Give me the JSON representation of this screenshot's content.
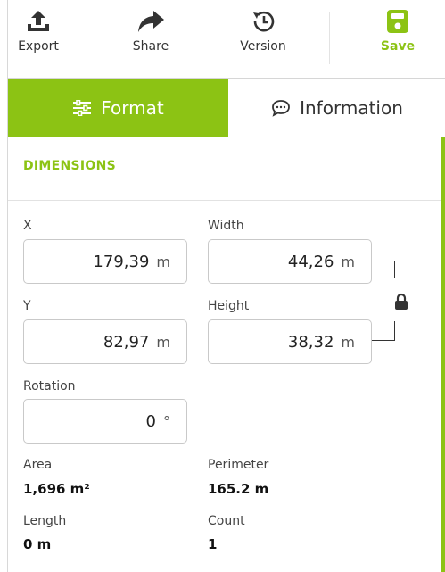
{
  "toolbar": {
    "export_label": "Export",
    "share_label": "Share",
    "version_label": "Version",
    "save_label": "Save",
    "accent_color": "#8cc314"
  },
  "tabs": {
    "format_label": "Format",
    "information_label": "Information",
    "active": "Format"
  },
  "dimensions": {
    "section_title": "DIMENSIONS",
    "x": {
      "label": "X",
      "value": "179,39",
      "unit": "m"
    },
    "width": {
      "label": "Width",
      "value": "44,26",
      "unit": "m"
    },
    "y": {
      "label": "Y",
      "value": "82,97",
      "unit": "m"
    },
    "height": {
      "label": "Height",
      "value": "38,32",
      "unit": "m"
    },
    "rotation": {
      "label": "Rotation",
      "value": "0",
      "unit": "°"
    },
    "aspect_lock_icon": "lock-icon"
  },
  "info": {
    "area": {
      "label": "Area",
      "value": "1,696 m²"
    },
    "perimeter": {
      "label": "Perimeter",
      "value": "165.2 m"
    },
    "length": {
      "label": "Length",
      "value": "0 m"
    },
    "count": {
      "label": "Count",
      "value": "1"
    }
  }
}
